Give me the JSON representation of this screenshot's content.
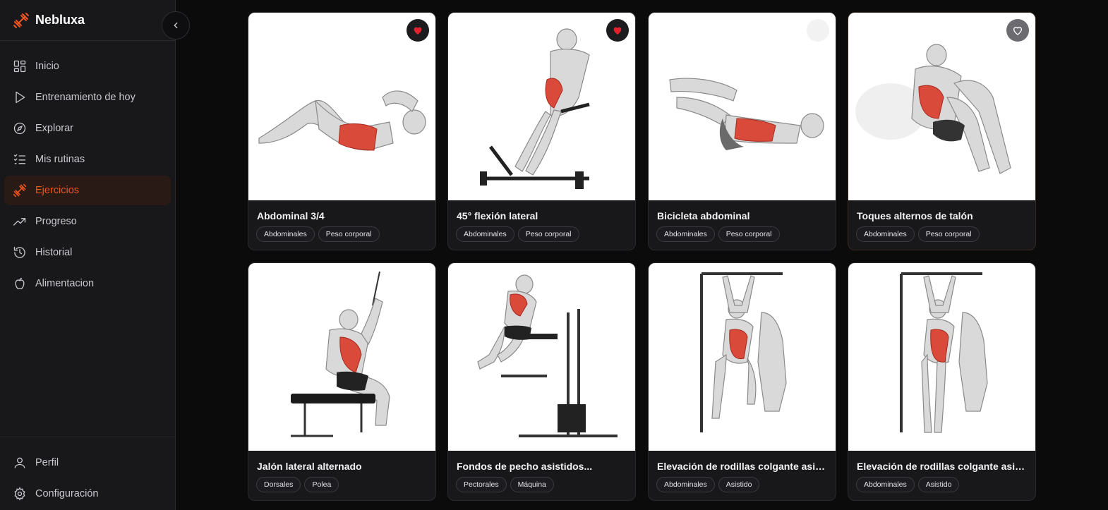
{
  "app": {
    "name": "Nebluxa"
  },
  "colors": {
    "accent": "#f0541f",
    "background": "#0b0b0c",
    "sidebar": "#18181b",
    "favorite": "#e5212d"
  },
  "sidebar": {
    "items": [
      {
        "label": "Inicio",
        "icon": "grid-icon",
        "active": false
      },
      {
        "label": "Entrenamiento de hoy",
        "icon": "play-icon",
        "active": false
      },
      {
        "label": "Explorar",
        "icon": "compass-icon",
        "active": false
      },
      {
        "label": "Mis rutinas",
        "icon": "checklist-icon",
        "active": false
      },
      {
        "label": "Ejercicios",
        "icon": "dumbbell-icon",
        "active": true
      },
      {
        "label": "Progreso",
        "icon": "trending-up-icon",
        "active": false
      },
      {
        "label": "Historial",
        "icon": "history-icon",
        "active": false
      },
      {
        "label": "Alimentacion",
        "icon": "apple-icon",
        "active": false
      }
    ],
    "bottom": [
      {
        "label": "Perfil",
        "icon": "user-icon"
      },
      {
        "label": "Configuración",
        "icon": "gear-icon"
      }
    ]
  },
  "exercises": [
    {
      "title": "Abdominal 3/4",
      "tags": [
        "Abdominales",
        "Peso corporal"
      ],
      "favorite": "on"
    },
    {
      "title": "45° flexión lateral",
      "tags": [
        "Abdominales",
        "Peso corporal"
      ],
      "favorite": "on"
    },
    {
      "title": "Bicicleta abdominal",
      "tags": [
        "Abdominales",
        "Peso corporal"
      ],
      "favorite": "empty"
    },
    {
      "title": "Toques alternos de talón",
      "tags": [
        "Abdominales",
        "Peso corporal"
      ],
      "favorite": "off"
    },
    {
      "title": "Jalón lateral alternado",
      "tags": [
        "Dorsales",
        "Polea"
      ],
      "favorite": "none"
    },
    {
      "title": "Fondos de pecho asistidos...",
      "tags": [
        "Pectorales",
        "Máquina"
      ],
      "favorite": "none"
    },
    {
      "title": "Elevación de rodillas colgante asisti...",
      "tags": [
        "Abdominales",
        "Asistido"
      ],
      "favorite": "none"
    },
    {
      "title": "Elevación de rodillas colgante asistida",
      "tags": [
        "Abdominales",
        "Asistido"
      ],
      "favorite": "none"
    }
  ]
}
